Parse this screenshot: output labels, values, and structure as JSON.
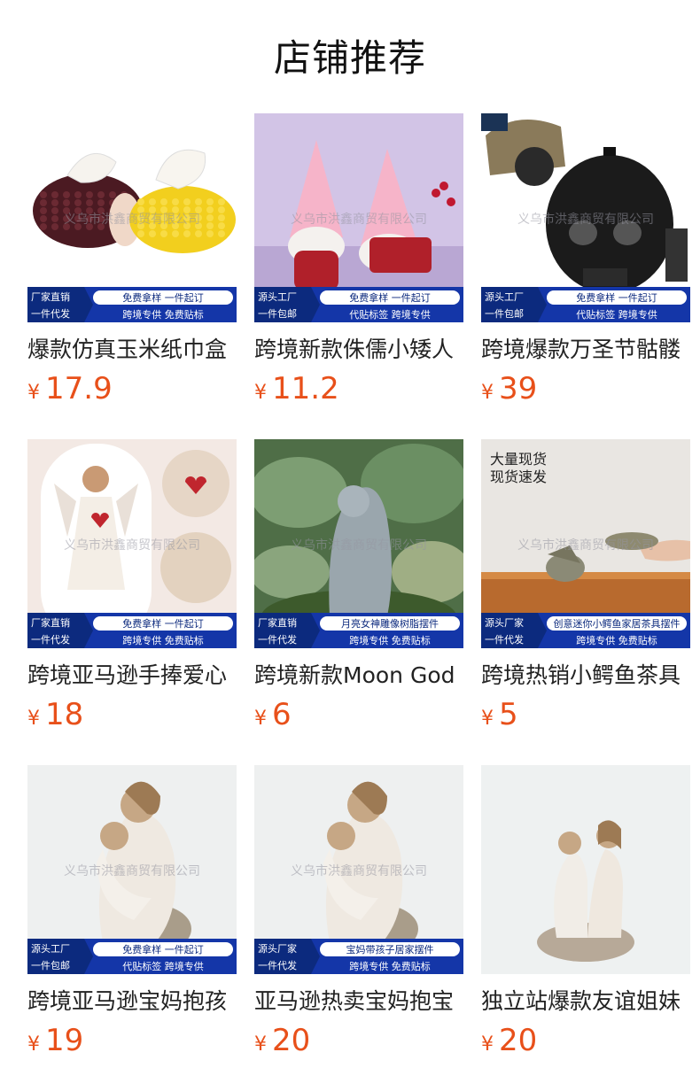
{
  "header": {
    "title": "店铺推荐"
  },
  "currency_symbol": "¥",
  "products": [
    {
      "name": "爆款仿真玉米纸巾盒",
      "price": "17.9",
      "image": {
        "watermark": "义乌市洪鑫商贸有限公司",
        "banner_left_top": "厂家直销",
        "banner_left_bottom": "一件代发",
        "banner_right_top": "免费拿样  一件起订",
        "banner_right_bottom": "跨境专供  免费贴标",
        "bg": "#ffffff"
      }
    },
    {
      "name": "跨境新款侏儒小矮人",
      "price": "11.2",
      "image": {
        "watermark": "义乌市洪鑫商贸有限公司",
        "banner_left_top": "源头工厂",
        "banner_left_bottom": "一件包邮",
        "banner_right_top": "免费拿样  一件起订",
        "banner_right_bottom": "代贴标签  跨境专供",
        "bg": "#c9b6dd"
      }
    },
    {
      "name": "跨境爆款万圣节骷髅",
      "price": "39",
      "image": {
        "watermark": "义乌市洪鑫商贸有限公司",
        "banner_left_top": "源头工厂",
        "banner_left_bottom": "一件包邮",
        "banner_right_top": "免费拿样  一件起订",
        "banner_right_bottom": "代贴标签  跨境专供",
        "bg": "#ffffff"
      }
    },
    {
      "name": "跨境亚马逊手捧爱心",
      "price": "18",
      "image": {
        "watermark": "义乌市洪鑫商贸有限公司",
        "banner_left_top": "厂家直销",
        "banner_left_bottom": "一件代发",
        "banner_right_top": "免费拿样  一件起订",
        "banner_right_bottom": "跨境专供  免费贴标",
        "bg": "#f3e9e4"
      }
    },
    {
      "name": "跨境新款Moon God",
      "price": "6",
      "image": {
        "watermark": "义乌市洪鑫商贸有限公司",
        "banner_left_top": "厂家直销",
        "banner_left_bottom": "一件代发",
        "banner_right_top": "月亮女神雕像树脂摆件",
        "banner_right_bottom": "跨境专供  免费贴标",
        "bg": "#6a8a5a"
      }
    },
    {
      "name": "跨境热销小鳄鱼茶具",
      "price": "5",
      "image": {
        "watermark": "义乌市洪鑫商贸有限公司",
        "overlay_text": [
          "大量现货",
          "现货速发"
        ],
        "banner_left_top": "源头厂家",
        "banner_left_bottom": "一件代发",
        "banner_right_top": "创意迷你小鳄鱼家居茶具摆件",
        "banner_right_bottom": "跨境专供  免费贴标",
        "bg": "#e9e6e2"
      }
    },
    {
      "name": "跨境亚马逊宝妈抱孩",
      "price": "19",
      "image": {
        "watermark": "义乌市洪鑫商贸有限公司",
        "banner_left_top": "源头工厂",
        "banner_left_bottom": "一件包邮",
        "banner_right_top": "免费拿样  一件起订",
        "banner_right_bottom": "代贴标签  跨境专供",
        "bg": "#eef0f0"
      }
    },
    {
      "name": "亚马逊热卖宝妈抱宝",
      "price": "20",
      "image": {
        "watermark": "义乌市洪鑫商贸有限公司",
        "banner_left_top": "源头厂家",
        "banner_left_bottom": "一件代发",
        "banner_right_top": "宝妈带孩子居家摆件",
        "banner_right_bottom": "跨境专供  免费贴标",
        "bg": "#eef0f0"
      }
    },
    {
      "name": "独立站爆款友谊姐妹",
      "price": "20",
      "image": {
        "bg": "#eef1f1"
      }
    }
  ],
  "colors": {
    "price": "#e8501a",
    "banner_blue": "#1436a8",
    "banner_dark": "#0c2a7e"
  }
}
